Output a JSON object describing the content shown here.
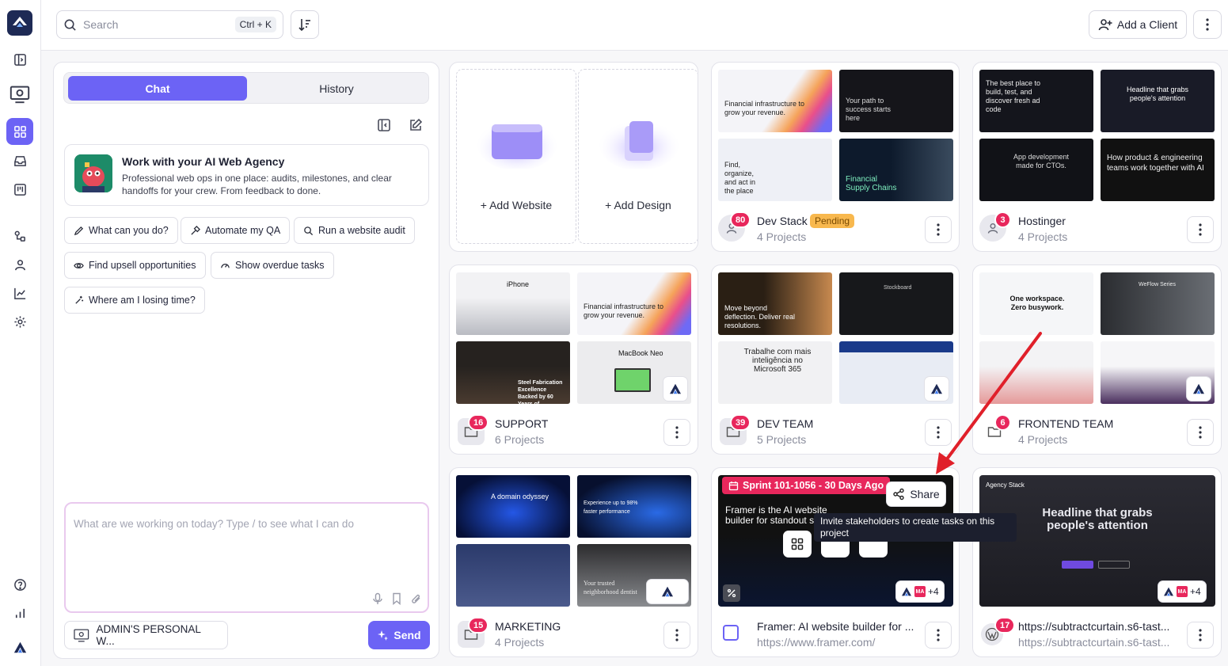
{
  "search": {
    "placeholder": "Search",
    "shortcut": "Ctrl + K"
  },
  "topbar": {
    "add_client": "Add a Client"
  },
  "chat": {
    "tab_chat": "Chat",
    "tab_history": "History",
    "intro_title": "Work with your AI Web Agency",
    "intro_desc": "Professional web ops in one place: audits, milestones, and clear handoffs for your crew. From feedback to done.",
    "chips": [
      "What can you do?",
      "Automate my QA",
      "Run a website audit",
      "Find upsell opportunities",
      "Show overdue tasks",
      "Where am I losing time?"
    ],
    "prompt_placeholder": "What are we working on today? Type / to see what I can do",
    "workspace": "ADMIN'S PERSONAL W...",
    "send": "Send"
  },
  "add_card": {
    "add_website": "+ Add Website",
    "add_design": "+ Add Design"
  },
  "cards": {
    "devstack": {
      "name": "Dev Stack",
      "status": "Pending",
      "sub": "4 Projects",
      "count": "80"
    },
    "hostinger": {
      "name": "Hostinger",
      "sub": "4 Projects",
      "count": "3"
    },
    "support": {
      "name": "SUPPORT",
      "sub": "6 Projects",
      "count": "16"
    },
    "devteam": {
      "name": "DEV TEAM",
      "sub": "5 Projects",
      "count": "39"
    },
    "frontend": {
      "name": "FRONTEND TEAM",
      "sub": "4 Projects",
      "count": "6"
    },
    "marketing": {
      "name": "MARKETING",
      "sub": "4 Projects",
      "count": "15"
    },
    "framer": {
      "sprint": "Sprint 101-1056 - 30 Days Ago",
      "share": "Share",
      "tooltip": "Invite stakeholders to create tasks on this project",
      "name": "Framer: AI website builder for ...",
      "sub": "https://www.framer.com/",
      "plus": "+4",
      "hero": "Framer is the AI website builder for standout si"
    },
    "subtract": {
      "name": "https://subtractcurtain.s6-tast...",
      "sub": "https://subtractcurtain.s6-tast...",
      "count": "17",
      "plus": "+4",
      "brand": "Agency Stack",
      "headline": "Headline that grabs people's attention"
    }
  },
  "thumbs": {
    "dev1": "Financial infrastructure to grow your revenue.",
    "dev2": "Your path to success starts here",
    "dev3": "Find, organize, and act in the place",
    "dev4": "Financial Supply Chains",
    "host1": "The best place to build, test, and discover fresh ad code",
    "host2": "Headline that grabs people's attention",
    "host3": "App development made for CTOs.",
    "host4": "How product & engineering teams work together with AI",
    "sup1": "iPhone",
    "sup2": "Financial infrastructure to grow your revenue.",
    "sup3": "Steel Fabrication Excellence Backed by 60 Years of",
    "sup4": "MacBook Neo",
    "dt1": "Move beyond deflection. Deliver real resolutions.",
    "dt2": "Stockboard",
    "dt3": "Trabalhe com mais inteligência no Microsoft 365",
    "fe1": "One workspace. Zero busywork.",
    "fe2": "WeFlow Series",
    "mk1": "A domain odyssey",
    "mk2": "Experience up to 98% faster performance",
    "mk4": "Your trusted neighborhood dentist"
  },
  "colors": {
    "accent": "#6c63f5",
    "badge": "#e8275c",
    "pending": "#f8b84e",
    "arrow": "#e0202a"
  }
}
